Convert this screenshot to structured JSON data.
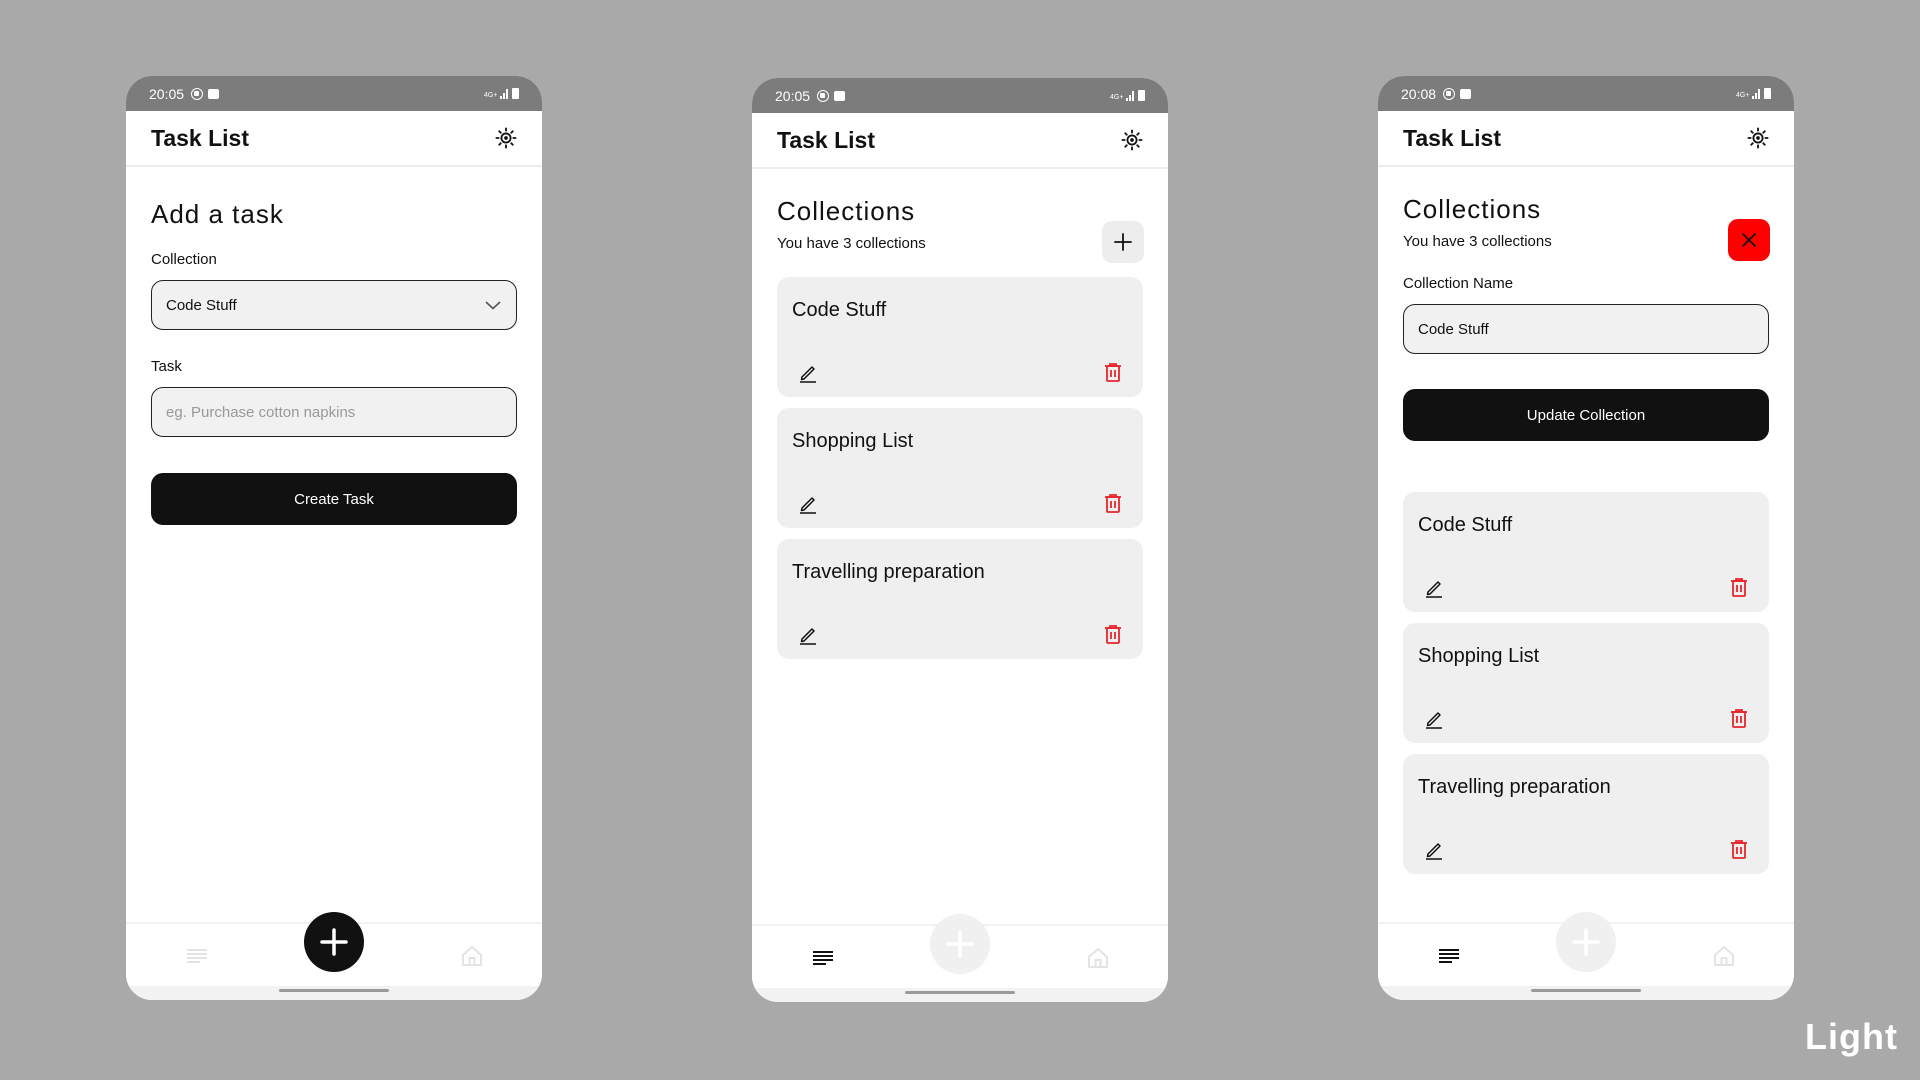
{
  "colors": {
    "background": "#a9a9a9",
    "status_bar": "#7c7c7c",
    "primary_button": "#111111",
    "card": "#efefef",
    "delete": "#e8262b",
    "close_button": "#ff0000"
  },
  "theme_label": "Light",
  "screens": [
    {
      "status_time": "20:05",
      "status_network": "4G+",
      "app_title": "Task List",
      "heading": "Add a task",
      "collection_label": "Collection",
      "collection_value": "Code Stuff",
      "task_label": "Task",
      "task_placeholder": "eg. Purchase cotton napkins",
      "button_label": "Create Task",
      "icons": [
        "theme-brightness-icon",
        "chevron-down-icon",
        "list-icon",
        "plus-icon",
        "home-icon"
      ]
    },
    {
      "status_time": "20:05",
      "status_network": "4G+",
      "app_title": "Task List",
      "heading": "Collections",
      "subtitle": "You have 3 collections",
      "cards": [
        {
          "title": "Code Stuff"
        },
        {
          "title": "Shopping List"
        },
        {
          "title": "Travelling preparation"
        }
      ],
      "icons": [
        "theme-brightness-icon",
        "plus-icon",
        "pencil-icon",
        "trash-icon",
        "list-icon",
        "home-icon"
      ]
    },
    {
      "status_time": "20:08",
      "status_network": "4G+",
      "app_title": "Task List",
      "heading": "Collections",
      "subtitle": "You have 3 collections",
      "name_label": "Collection Name",
      "name_value": "Code Stuff",
      "button_label": "Update Collection",
      "cards": [
        {
          "title": "Code Stuff"
        },
        {
          "title": "Shopping List"
        },
        {
          "title": "Travelling preparation"
        }
      ],
      "icons": [
        "theme-brightness-icon",
        "close-icon",
        "pencil-icon",
        "trash-icon",
        "list-icon",
        "plus-icon",
        "home-icon"
      ]
    }
  ]
}
